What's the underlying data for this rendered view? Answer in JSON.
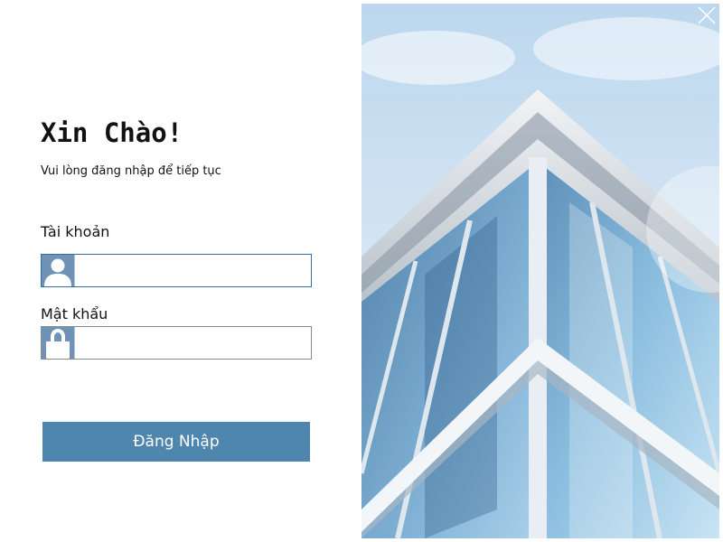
{
  "login": {
    "title": "Xin Chào!",
    "subtitle": "Vui lòng đăng nhập để tiếp tục",
    "username": {
      "label": "Tài khoản",
      "value": "",
      "icon": "user-icon"
    },
    "password": {
      "label": "Mật khẩu",
      "value": "",
      "icon": "lock-icon"
    },
    "submit_label": "Đăng Nhập"
  },
  "window": {
    "close_icon": "close-icon"
  },
  "colors": {
    "accent": "#4f86ad",
    "icon_bg": "#6e93b6",
    "focused_border": "#2f6ea8"
  }
}
